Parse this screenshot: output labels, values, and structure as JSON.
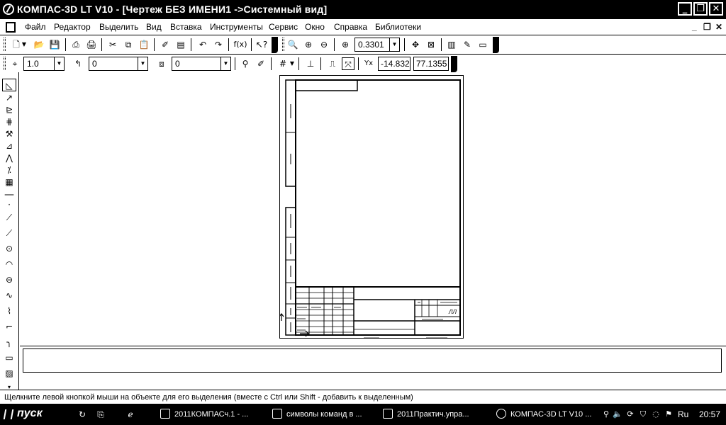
{
  "window": {
    "title": "КОМПАС-3D LT V10 - [Чертеж БЕЗ ИМЕНИ1 ->Системный вид]",
    "minimize": "_",
    "restore": "❐",
    "close": "✕"
  },
  "menubar": {
    "items": [
      "Файл",
      "Редактор",
      "Выделить",
      "Вид",
      "Вставка",
      "Инструменты",
      "Сервис",
      "Окно",
      "Справка",
      "Библиотеки"
    ],
    "mdi_minimize": "_",
    "mdi_restore": "❐",
    "mdi_close": "✕"
  },
  "toolbar_standard": {
    "zoom_value": "0.3301"
  },
  "toolbar_current_state": {
    "step_value": "1.0",
    "layer_value": "0",
    "style_value": "0",
    "y_label": "Y",
    "x_label": "x",
    "coord_x": "-14.832",
    "coord_y": "77.1355"
  },
  "statusbar": {
    "message": "Щелкните левой кнопкой мыши на объекте для его выделения (вместе с Ctrl или Shift - добавить к выделенным)"
  },
  "taskbar": {
    "start_label": "пуск",
    "tasks": [
      {
        "label": "2011КОМПАСч.1 - ...",
        "icon": "word-doc-icon"
      },
      {
        "label": "символы команд в ...",
        "icon": "word-doc-icon"
      },
      {
        "label": "2011Практич.упра...",
        "icon": "folder-icon"
      },
      {
        "label": "КОМПАС-3D LT V10 ...",
        "icon": "kompas-icon"
      }
    ],
    "language": "Ru",
    "clock": "20:57"
  },
  "drawing": {
    "stamp_mark": "ЛЛ"
  }
}
